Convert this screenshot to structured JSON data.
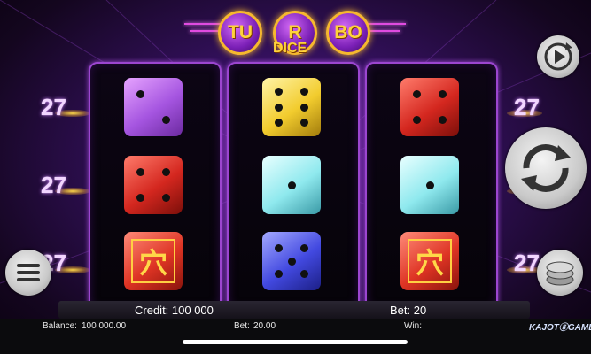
{
  "logo": {
    "left": "TU",
    "mid": "R",
    "right": "BO",
    "sub": "DICE"
  },
  "line_numbers": {
    "left": [
      "27",
      "27",
      "27"
    ],
    "right": [
      "27",
      "27",
      "27"
    ]
  },
  "reels": [
    [
      {
        "color": "purple",
        "pips": 2
      },
      {
        "color": "red",
        "pips": 4
      },
      {
        "color": "glyph",
        "symbol": "穴"
      }
    ],
    [
      {
        "color": "yellow",
        "pips": 6
      },
      {
        "color": "cyan",
        "pips": 1
      },
      {
        "color": "blue",
        "pips": 5
      }
    ],
    [
      {
        "color": "red",
        "pips": 4
      },
      {
        "color": "cyan",
        "pips": 1
      },
      {
        "color": "glyph",
        "symbol": "穴"
      }
    ]
  ],
  "colors": {
    "purple": "#b35ee8",
    "red": "#d4271f",
    "yellow": "#f2cc2e",
    "cyan": "#8fe9ee",
    "blue": "#4249e0",
    "accent": "#ffd33a"
  },
  "info_bar": {
    "credit": "Credit: 100 000",
    "bet": "Bet: 20"
  },
  "status_bar": {
    "balance_label": "Balance:",
    "balance_value": "100 000.00",
    "bet_label": "Bet:",
    "bet_value": "20.00",
    "win_label": "Win:"
  },
  "brand": "KAJOTⓖGAMES",
  "icons": {
    "autoplay": "play-circle-icon",
    "spin": "spin-arrows-icon",
    "menu": "hamburger-icon",
    "chips": "chip-stack-icon"
  }
}
